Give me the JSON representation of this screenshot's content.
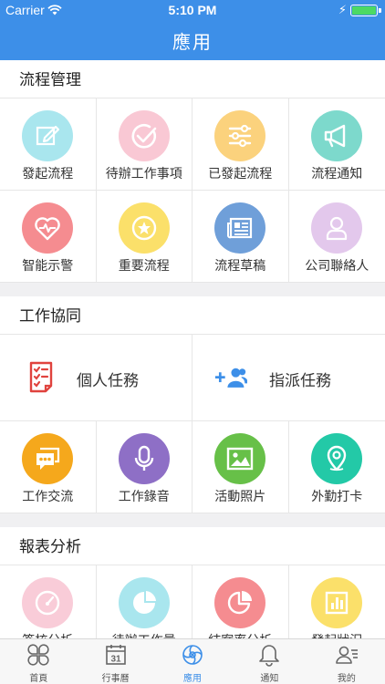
{
  "status": {
    "carrier": "Carrier",
    "time": "5:10 PM"
  },
  "header": {
    "title": "應用"
  },
  "sections": {
    "process": {
      "title": "流程管理",
      "items": [
        {
          "label": "發起流程",
          "icon": "edit-icon",
          "color": "#a9e6ee"
        },
        {
          "label": "待辦工作事項",
          "icon": "check-circle-icon",
          "color": "#f9c8d4"
        },
        {
          "label": "已發起流程",
          "icon": "sliders-icon",
          "color": "#fbd27d"
        },
        {
          "label": "流程通知",
          "icon": "megaphone-icon",
          "color": "#7dd9cc"
        },
        {
          "label": "智能示警",
          "icon": "heart-pulse-icon",
          "color": "#f58c90"
        },
        {
          "label": "重要流程",
          "icon": "star-badge-icon",
          "color": "#fbe06a"
        },
        {
          "label": "流程草稿",
          "icon": "newspaper-icon",
          "color": "#6f9fd9"
        },
        {
          "label": "公司聯絡人",
          "icon": "person-icon",
          "color": "#e3c8ec"
        }
      ]
    },
    "collab": {
      "title": "工作協同",
      "big_items": [
        {
          "label": "個人任務",
          "icon": "checklist-icon"
        },
        {
          "label": "指派任務",
          "icon": "add-group-icon"
        }
      ],
      "items": [
        {
          "label": "工作交流",
          "icon": "chat-icon",
          "color": "#f5a81c"
        },
        {
          "label": "工作錄音",
          "icon": "microphone-icon",
          "color": "#8e6fc6"
        },
        {
          "label": "活動照片",
          "icon": "image-icon",
          "color": "#67c048"
        },
        {
          "label": "外勤打卡",
          "icon": "location-pin-icon",
          "color": "#23c9a7"
        }
      ]
    },
    "reports": {
      "title": "報表分析",
      "items": [
        {
          "label": "簽核分析",
          "icon": "gauge-icon",
          "color": "#f9ccd8"
        },
        {
          "label": "待辦工作量",
          "icon": "pie-chart-icon",
          "color": "#a9e6ee"
        },
        {
          "label": "結案率分析",
          "icon": "pie-slice-icon",
          "color": "#f58c90"
        },
        {
          "label": "發起狀況",
          "icon": "bar-chart-icon",
          "color": "#fbe06a"
        }
      ]
    }
  },
  "tabbar": {
    "tabs": [
      {
        "label": "首頁",
        "icon": "clover-icon"
      },
      {
        "label": "行事曆",
        "icon": "calendar-icon"
      },
      {
        "label": "應用",
        "icon": "apps-swirl-icon"
      },
      {
        "label": "通知",
        "icon": "bell-icon"
      },
      {
        "label": "我的",
        "icon": "profile-list-icon"
      }
    ],
    "calendar_day": "31",
    "active_color": "#3d8fe8"
  }
}
